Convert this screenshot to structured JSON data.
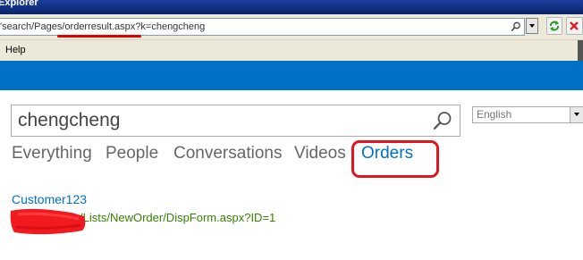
{
  "browser": {
    "title": "Explorer",
    "address": "'search/Pages/orderresult.aspx?k=chengcheng",
    "menu": {
      "help_label": "Help"
    }
  },
  "colors": {
    "suite_bar": "#0072c6",
    "link": "#0072c6",
    "url_green": "#338200",
    "annotation_red": "#e0161e"
  },
  "search": {
    "query": "chengcheng",
    "icon": "search-icon",
    "language": "English"
  },
  "verticals": [
    {
      "label": "Everything",
      "active": false
    },
    {
      "label": "People",
      "active": false
    },
    {
      "label": "Conversations",
      "active": false
    },
    {
      "label": "Videos",
      "active": false
    },
    {
      "label": "Orders",
      "active": true
    }
  ],
  "results": [
    {
      "title": "Customer123",
      "url": "/Lists/NewOrder/DispForm.aspx?ID=1"
    }
  ]
}
